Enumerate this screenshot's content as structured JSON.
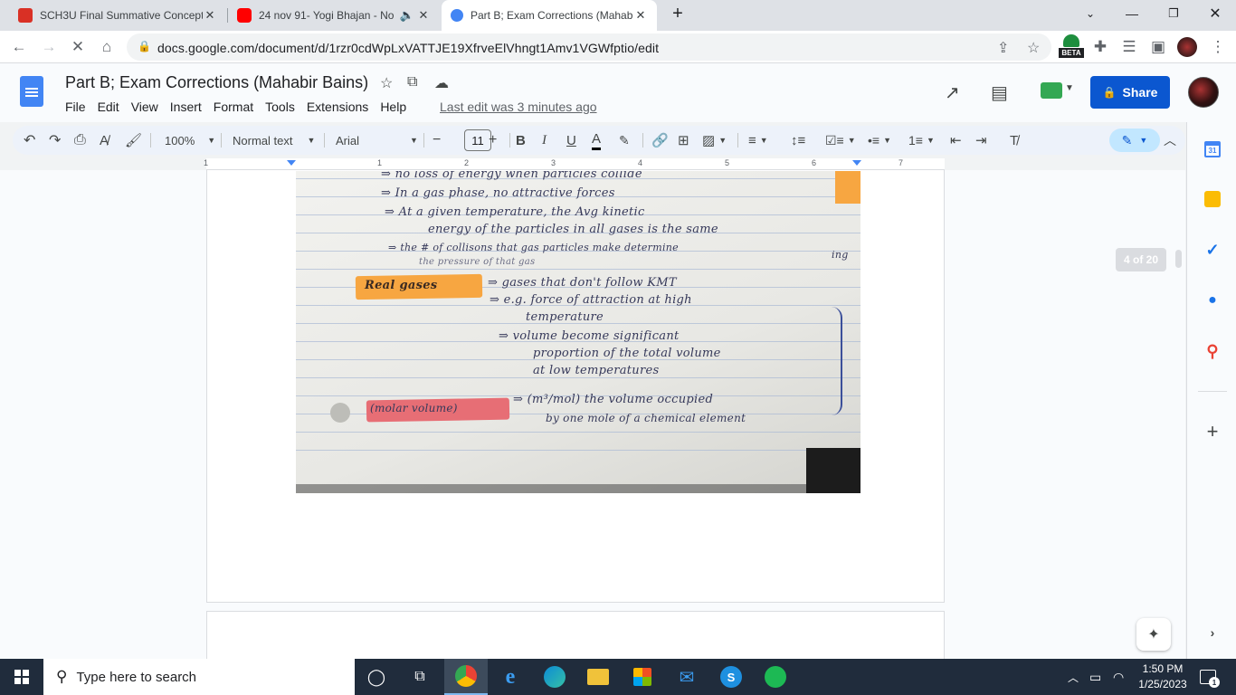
{
  "browser": {
    "tabs": [
      {
        "title": "SCH3U Final Summative Concept",
        "favicon_color": "#d93025",
        "active": false
      },
      {
        "title": "24 nov 91- Yogi Bhajan - No",
        "favicon_color": "#ff0000",
        "active": false,
        "audio": true
      },
      {
        "title": "Part B; Exam Corrections (Mahab",
        "favicon_color": "#4285f4",
        "active": true
      }
    ],
    "url": "docs.google.com/document/d/1rzr0cdWpLxVATTJE19XfrveElVhngt1Amv1VGWfptio/edit",
    "beta_label": "BETA"
  },
  "docs": {
    "title": "Part B; Exam Corrections (Mahabir Bains)",
    "menu": [
      "File",
      "Edit",
      "View",
      "Insert",
      "Format",
      "Tools",
      "Extensions",
      "Help"
    ],
    "last_edit": "Last edit was 3 minutes ago",
    "share_label": "Share",
    "toolbar": {
      "zoom": "100%",
      "style": "Normal text",
      "font": "Arial",
      "font_size": "11",
      "bold": "B",
      "italic": "I",
      "underline": "U",
      "text_color": "A"
    },
    "ruler_numbers": [
      "1",
      "1",
      "2",
      "3",
      "4",
      "5",
      "6",
      "7"
    ],
    "page_counter": "4 of 20",
    "notes": {
      "line1": "⇒ no loss of energy when particles collide",
      "line2": "⇒ In a gas phase, no attractive forces",
      "line3": "⇒ At a given temperature, the Avg kinetic",
      "line4": "energy of the particles in all gases is the same",
      "line5": "⇒ the # of collisons that gas particles make determine",
      "line6": "the pressure of that gas",
      "real_gases_label": "Real gases",
      "line7": "⇒ gases that don't follow KMT",
      "line8": "⇒ e.g. force of attraction at high",
      "line9": "temperature",
      "line10": "⇒ volume become significant",
      "line11": "proportion of the total volume",
      "line12": "at low temperatures",
      "molar_volume_label": "(molar volume)",
      "line13": "⇒ (m³/mol) the volume occupied",
      "line14": "by one mole of a chemical element",
      "margin_note": "ing"
    }
  },
  "taskbar": {
    "search_placeholder": "Type here to search",
    "time": "1:50 PM",
    "date": "1/25/2023",
    "notification_count": "1"
  }
}
